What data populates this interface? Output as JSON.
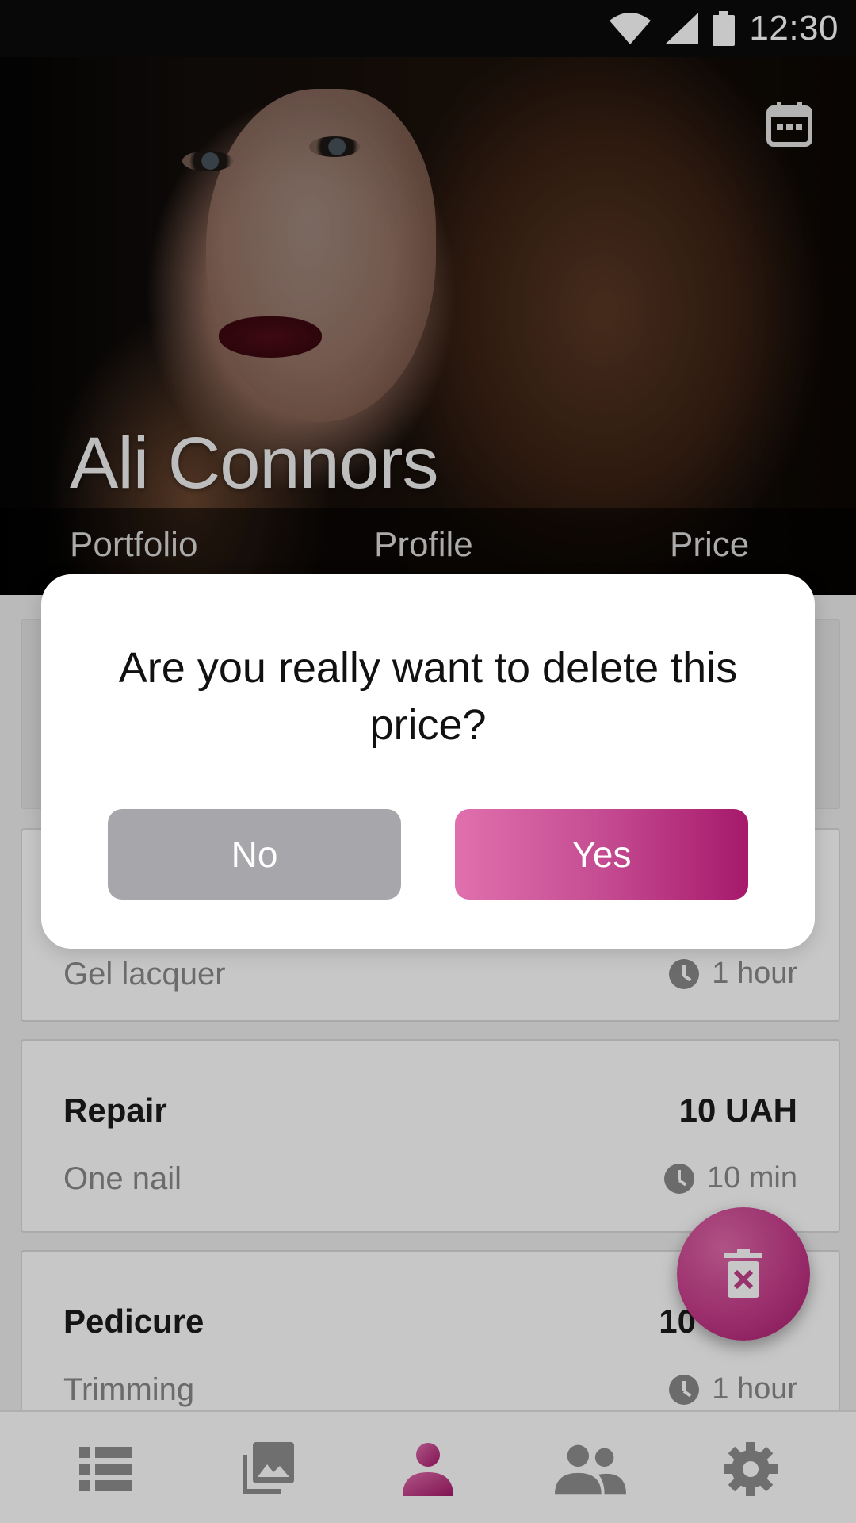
{
  "status_bar": {
    "time": "12:30",
    "icons": [
      "wifi-icon",
      "cell-signal-icon",
      "battery-icon"
    ]
  },
  "header": {
    "name": "Ali Connors",
    "calendar_icon": "calendar-icon",
    "tabs": [
      {
        "label": "Portfolio"
      },
      {
        "label": "Profile"
      },
      {
        "label": "Price"
      }
    ]
  },
  "price_list": [
    {
      "title": "",
      "price": "",
      "subtitle": "",
      "duration": ""
    },
    {
      "title": "",
      "price": "",
      "subtitle": "Gel lacquer",
      "duration": "1 hour"
    },
    {
      "title": "Repair",
      "price": "10 UAH",
      "subtitle": "One nail",
      "duration": "10 min"
    },
    {
      "title": "Pedicure",
      "price": "10",
      "subtitle": "Trimming",
      "duration": "1 hour"
    }
  ],
  "fab": {
    "icon": "delete-trash-icon"
  },
  "bottom_nav": {
    "items": [
      {
        "icon": "list-icon",
        "active": false
      },
      {
        "icon": "gallery-icon",
        "active": false
      },
      {
        "icon": "person-icon",
        "active": true
      },
      {
        "icon": "people-icon",
        "active": false
      },
      {
        "icon": "settings-gear-icon",
        "active": false
      }
    ]
  },
  "dialog": {
    "message": "Are you really want to delete this price?",
    "no_label": "No",
    "yes_label": "Yes"
  },
  "colors": {
    "accent": "#c54c92",
    "accent_dark": "#a6196b",
    "inactive_icon": "#8f8f8f",
    "no_button": "#a7a7ab"
  }
}
